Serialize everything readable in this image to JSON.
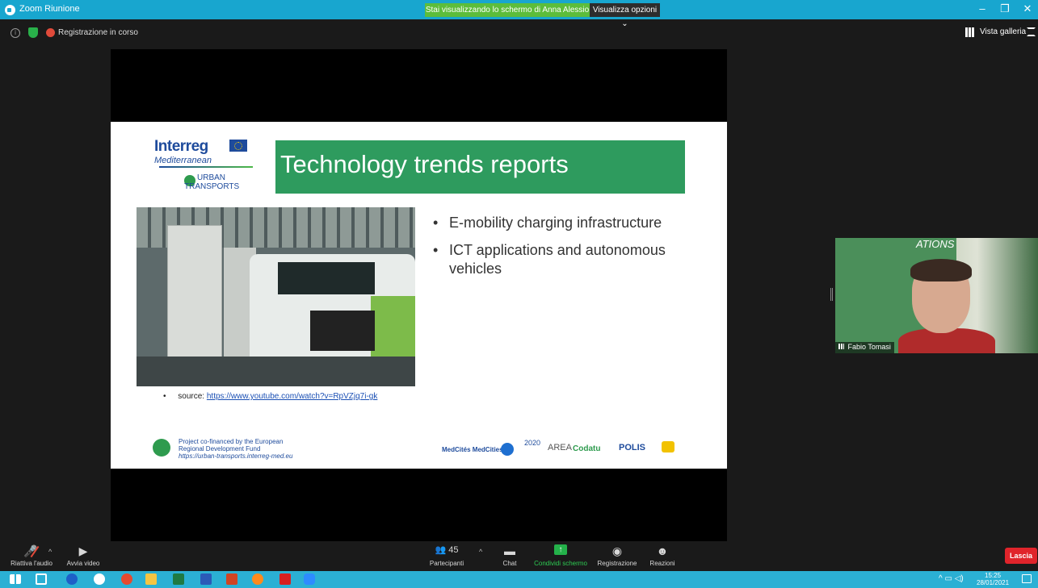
{
  "window": {
    "title": "Zoom Riunione",
    "share_banner": "Stai visualizzando lo schermo di Anna Alessio",
    "view_options": "Visualizza opzioni ⌄",
    "controls": [
      "–",
      "❐",
      "✕"
    ]
  },
  "info_bar": {
    "recording_label": "Registrazione in corso",
    "gallery_view_label": "Vista galleria"
  },
  "slide": {
    "logo": {
      "interreg": "Interreg",
      "mediterranean": "Mediterranean",
      "urban": "URBAN",
      "transports": "TRANSPORTS"
    },
    "title": "Technology trends reports",
    "bullets": [
      "E-mobility charging infrastructure",
      "ICT applications and autonomous vehicles"
    ],
    "source_prefix": "source:",
    "source_url": "https://www.youtube.com/watch?v=RpVZjq7i-gk",
    "cofinanced_line1": "Project co-financed by the European",
    "cofinanced_line2": "Regional Development Fund",
    "cofinanced_url": "https://urban-transports.interreg-med.eu",
    "partners": [
      "MedCités MedCities",
      "2020",
      "AREA",
      "Codatu",
      "POLIS"
    ]
  },
  "participant": {
    "name": "Fabio Tomasi",
    "poster_text": "ATIONS"
  },
  "toolbar": {
    "unmute_label": "Riattiva l'audio",
    "start_video_label": "Avvia video",
    "participants_count": "45",
    "participants_label": "Partecipanti",
    "chat_label": "Chat",
    "share_label": "Condividi schermo",
    "record_label": "Registrazione",
    "reactions_label": "Reazioni",
    "leave_label": "Lascia"
  },
  "taskbar": {
    "time": "15:25",
    "date": "28/01/2021",
    "apps": [
      "windows-start",
      "task-view",
      "edge",
      "chrome-alt",
      "chrome",
      "file-explorer",
      "excel",
      "word",
      "powerpoint",
      "firefox",
      "acrobat",
      "zoom"
    ]
  },
  "colors": {
    "titlebar": "#18a6cf",
    "share_banner": "#5cbd3b",
    "slide_title_band": "#2e9b5e",
    "leave_button": "#e0242b",
    "taskbar": "#2bb0d4"
  }
}
